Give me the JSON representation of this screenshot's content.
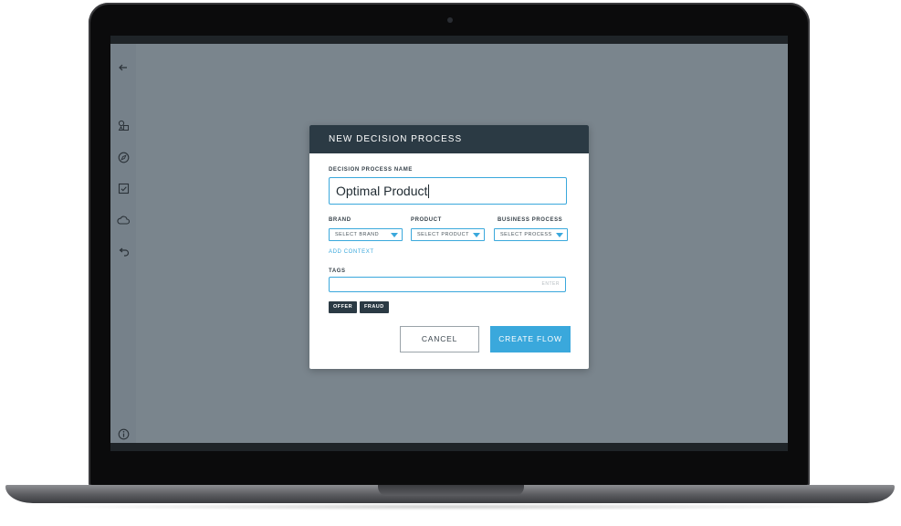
{
  "modal": {
    "title": "NEW DECISION PROCESS",
    "name_label": "DECISION PROCESS NAME",
    "name_value": "Optimal Product",
    "brand": {
      "label": "BRAND",
      "value": "SELECT BRAND"
    },
    "product": {
      "label": "PRODUCT",
      "value": "SELECT PRODUCT"
    },
    "business_process": {
      "label": "BUSINESS PROCESS",
      "value": "SELECT PROCESS"
    },
    "add_context": "ADD CONTEXT",
    "tags_label": "TAGS",
    "tags_hint": "ENTER",
    "tags": [
      "OFFER",
      "FRAUD"
    ],
    "cancel_label": "CANCEL",
    "create_label": "CREATE FLOW"
  },
  "sidebar": {
    "icons": [
      "back-arrow-icon",
      "shapes-icon",
      "compass-icon",
      "checkbox-icon",
      "cloud-icon",
      "undo-icon",
      "info-icon"
    ]
  },
  "colors": {
    "accent": "#3aa8dc",
    "header": "#2b3a44",
    "overlay": "#7a858d"
  }
}
